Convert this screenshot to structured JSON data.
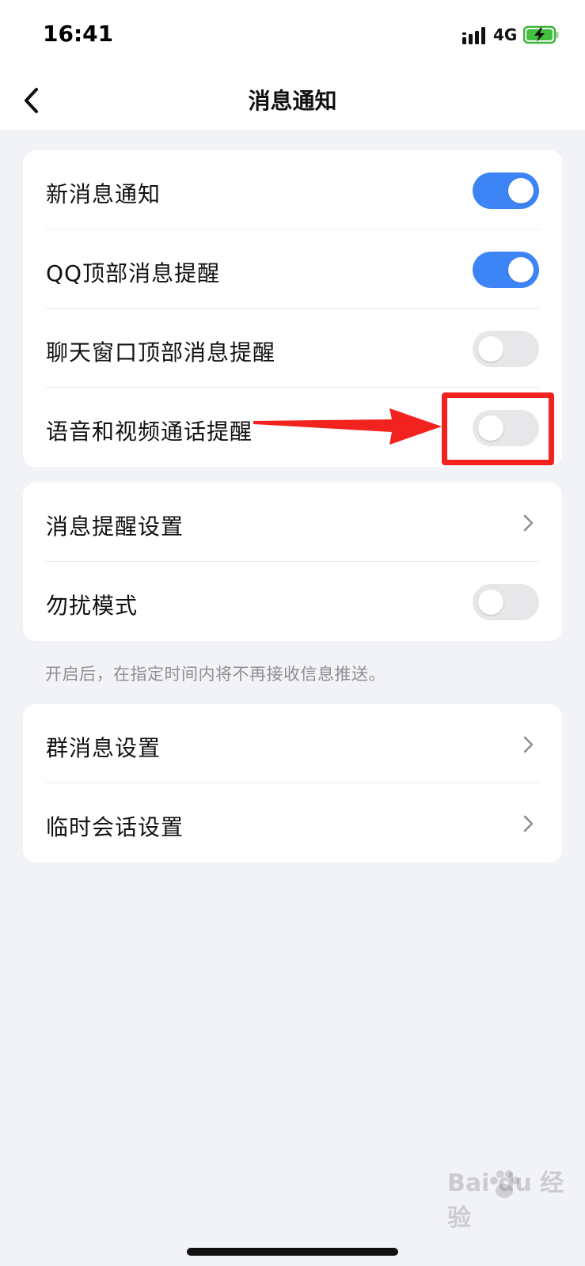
{
  "status_bar": {
    "time": "16:41",
    "network": "4G",
    "signal_icon": "signal-icon",
    "battery_icon": "battery-charging-icon"
  },
  "nav": {
    "title": "消息通知",
    "back_icon": "chevron-left-icon"
  },
  "groups": [
    {
      "items": [
        {
          "label": "新消息通知",
          "control": "toggle",
          "on": true
        },
        {
          "label": "QQ顶部消息提醒",
          "control": "toggle",
          "on": true
        },
        {
          "label": "聊天窗口顶部消息提醒",
          "control": "toggle",
          "on": false
        },
        {
          "label": "语音和视频通话提醒",
          "control": "toggle",
          "on": false
        }
      ]
    },
    {
      "items": [
        {
          "label": "消息提醒设置",
          "control": "chevron"
        },
        {
          "label": "勿扰模式",
          "control": "toggle",
          "on": false
        }
      ],
      "footer": "开启后，在指定时间内将不再接收信息推送。"
    },
    {
      "items": [
        {
          "label": "群消息设置",
          "control": "chevron"
        },
        {
          "label": "临时会话设置",
          "control": "chevron"
        }
      ]
    }
  ],
  "colors": {
    "toggle_on": "#3d84f6",
    "toggle_off": "#e7e7ea",
    "annotation": "#f2231f",
    "background": "#f2f3f7"
  },
  "watermark": "Bai du 经验"
}
